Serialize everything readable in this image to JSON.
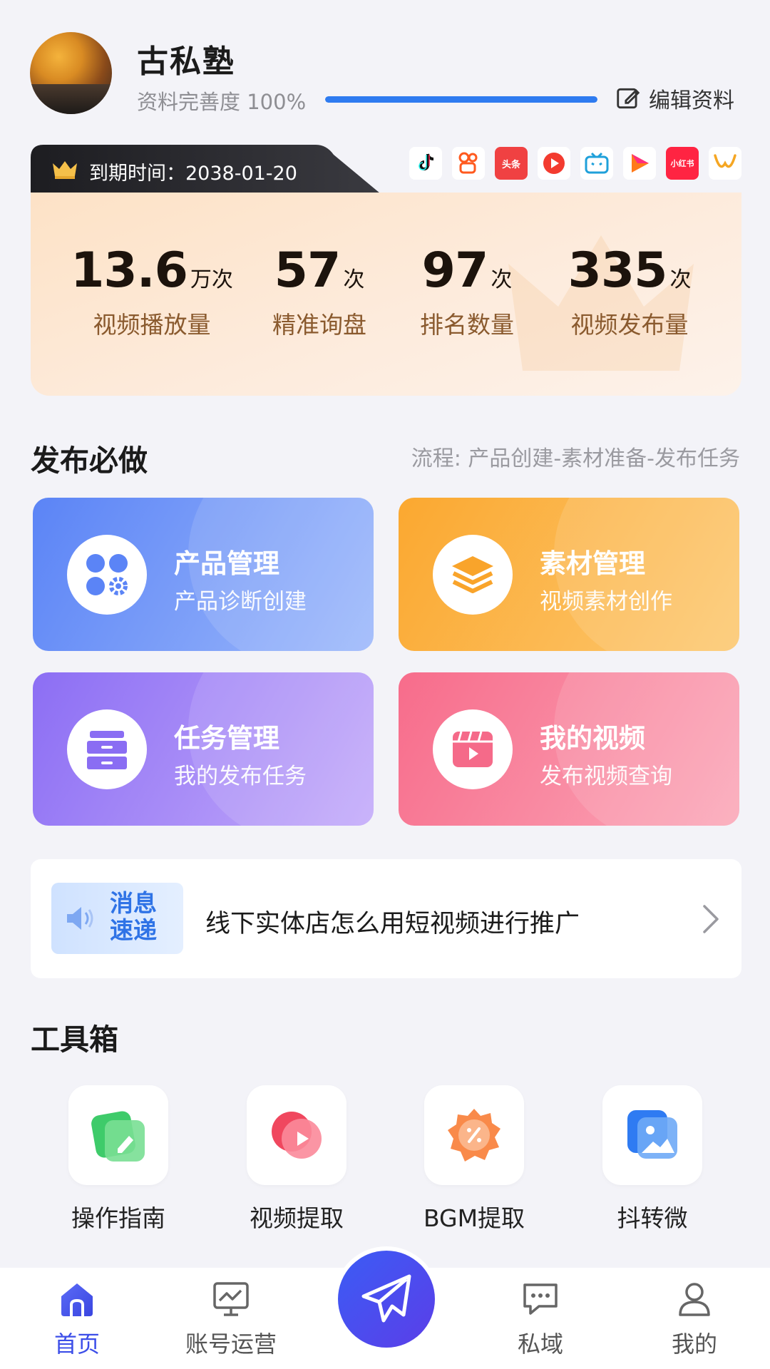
{
  "profile": {
    "name": "古私塾",
    "completeness_label": "资料完善度 100%",
    "completeness_percent": 100,
    "edit_label": "编辑资料"
  },
  "vip": {
    "expiry_label": "到期时间：2038-01-20"
  },
  "platforms": [
    {
      "name": "douyin-icon"
    },
    {
      "name": "kuaishou-icon"
    },
    {
      "name": "toutiao-icon",
      "text": "头条"
    },
    {
      "name": "xigua-icon"
    },
    {
      "name": "bilibili-icon"
    },
    {
      "name": "video-channel-icon"
    },
    {
      "name": "xiaohongshu-icon",
      "text": "小红书"
    },
    {
      "name": "wechat-channels-icon"
    }
  ],
  "stats": [
    {
      "value": "13.6",
      "unit": "万次",
      "label": "视频播放量"
    },
    {
      "value": "57",
      "unit": "次",
      "label": "精准询盘"
    },
    {
      "value": "97",
      "unit": "次",
      "label": "排名数量"
    },
    {
      "value": "335",
      "unit": "次",
      "label": "视频发布量"
    }
  ],
  "publish": {
    "title": "发布必做",
    "flow": "流程:  产品创建-素材准备-发布任务",
    "cards": [
      {
        "title": "产品管理",
        "subtitle": "产品诊断创建",
        "color_from": "#5b84f6",
        "color_to": "#9cb8fb"
      },
      {
        "title": "素材管理",
        "subtitle": "视频素材创作",
        "color_from": "#fba830",
        "color_to": "#fcc870"
      },
      {
        "title": "任务管理",
        "subtitle": "我的发布任务",
        "color_from": "#8c6ef4",
        "color_to": "#c3aafa"
      },
      {
        "title": "我的视频",
        "subtitle": "发布视频查询",
        "color_from": "#f76c8b",
        "color_to": "#fba7b8"
      }
    ]
  },
  "news": {
    "badge_line1": "消息",
    "badge_line2": "速递",
    "text": "线下实体店怎么用短视频进行推广"
  },
  "tools": {
    "title": "工具箱",
    "items": [
      {
        "label": "操作指南"
      },
      {
        "label": "视频提取"
      },
      {
        "label": "BGM提取"
      },
      {
        "label": "抖转微"
      }
    ]
  },
  "nav": {
    "items": [
      {
        "label": "首页"
      },
      {
        "label": "账号运营"
      },
      {
        "label": "私域"
      },
      {
        "label": "我的"
      }
    ]
  },
  "colors": {
    "accent": "#3c4ee8",
    "progress": "#2e7bf0"
  }
}
